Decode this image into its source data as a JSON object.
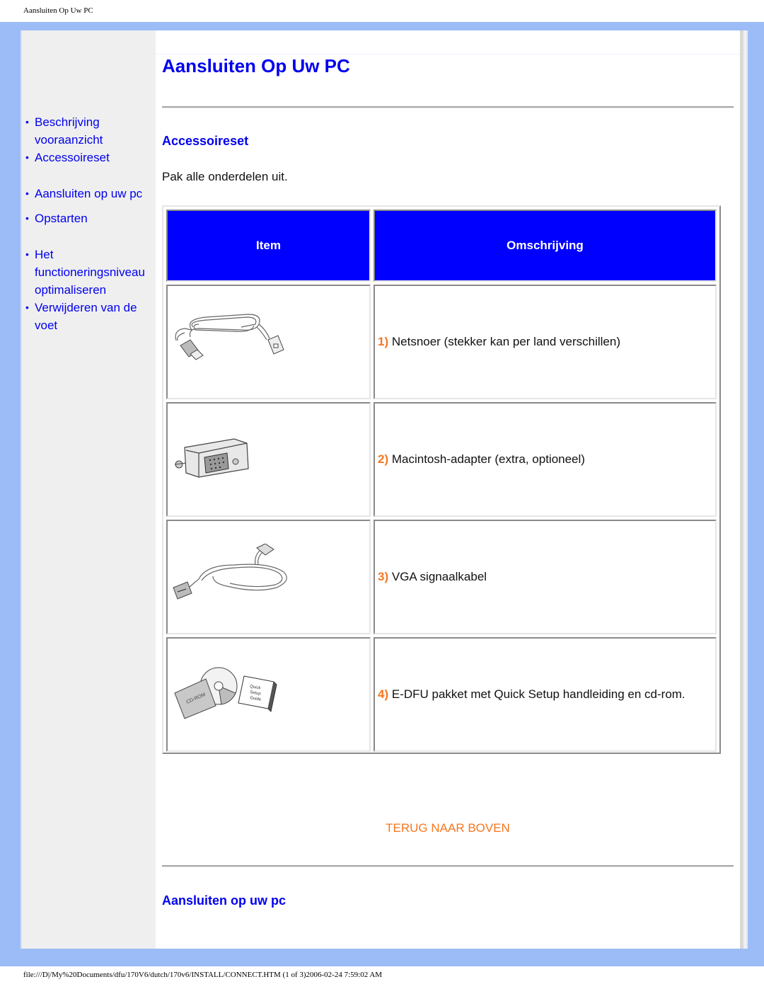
{
  "document": {
    "header_title": "Aansluiten Op Uw PC",
    "footer_path": "file:///D|/My%20Documents/dfu/170V6/dutch/170v6/INSTALL/CONNECT.HTM (1 of 3)2006-02-24 7:59:02 AM"
  },
  "sidebar": {
    "bullet": "•",
    "items": [
      {
        "label": "Beschrijving vooraanzicht"
      },
      {
        "label": "Accessoireset"
      },
      {
        "label": "Aansluiten op uw pc"
      },
      {
        "label": "Opstarten"
      },
      {
        "label": "Het functioneringsniveau optimaliseren"
      },
      {
        "label": "Verwijderen van de voet"
      }
    ]
  },
  "main": {
    "page_title": "Aansluiten Op Uw PC",
    "section1_title": "Accessoireset",
    "intro": "Pak alle onderdelen uit.",
    "table": {
      "headers": [
        "Item",
        "Omschrijving"
      ],
      "rows": [
        {
          "image_icon": "power-cord-icon",
          "number": "1)",
          "description": "Netsnoer (stekker kan per land verschillen)"
        },
        {
          "image_icon": "mac-adapter-icon",
          "number": "2)",
          "description": "Macintosh-adapter (extra, optioneel)"
        },
        {
          "image_icon": "vga-cable-icon",
          "number": "3)",
          "description": "VGA signaalkabel"
        },
        {
          "image_icon": "cd-rom-manual-icon",
          "number": "4)",
          "description": "E-DFU pakket met Quick Setup handleiding en cd-rom.",
          "cd_label": "CD-ROM",
          "guide_label": "Quick Setup Guide"
        }
      ]
    },
    "back_to_top": "TERUG NAAR BOVEN",
    "section2_title": "Aansluiten op uw pc"
  },
  "colors": {
    "link_blue": "#0000ee",
    "header_blue": "#0000ff",
    "accent_orange": "#f47721",
    "frame_blue": "#9bbcf6"
  }
}
